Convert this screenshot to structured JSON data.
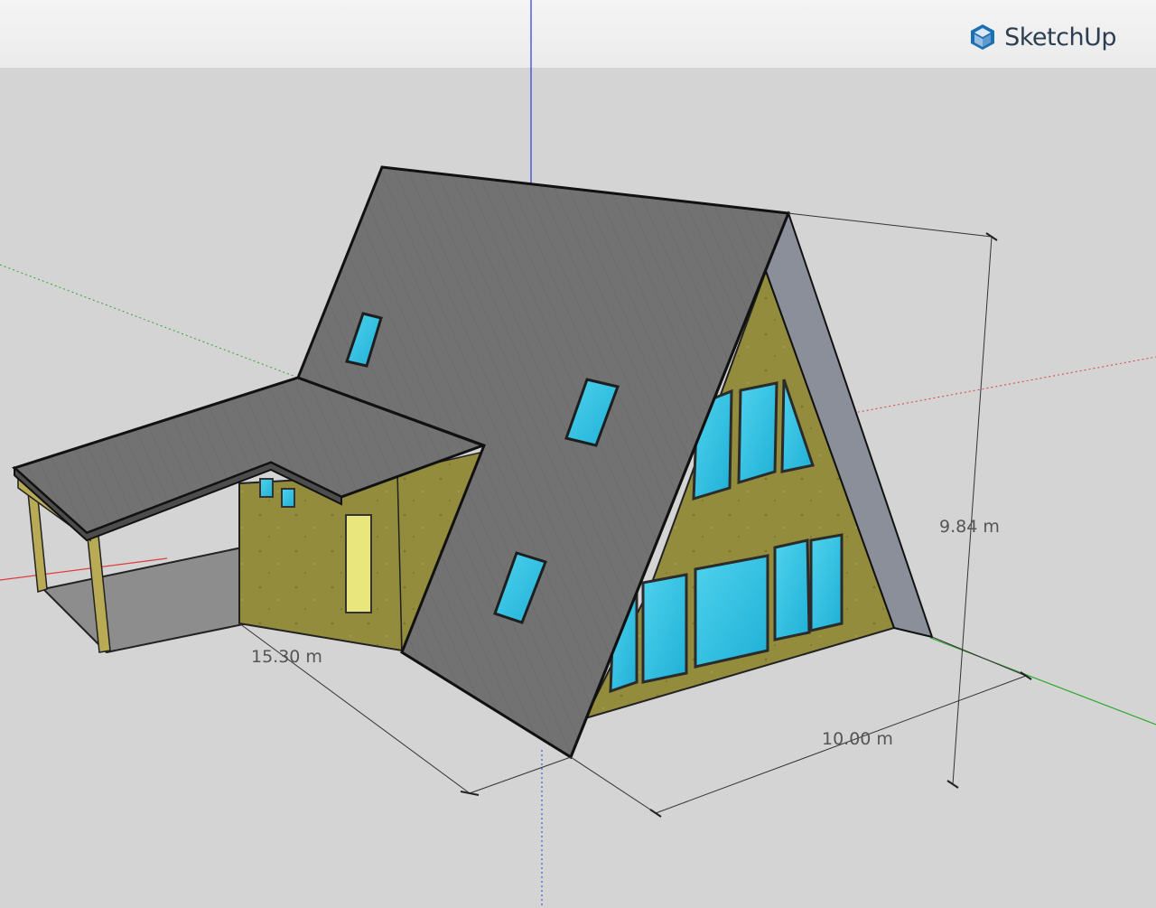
{
  "app": {
    "name": "SketchUp",
    "logo_icon": "sketchup-logo-icon"
  },
  "colors": {
    "sky": "#f0f0f0",
    "ground": "#d4d4d4",
    "roof": "#6f6f6f",
    "roof_edge": "#8a8f99",
    "wall": "#8f8a3a",
    "glass": "#35c3e3",
    "frame": "#c2b36a",
    "axis_red": "#e03a3a",
    "axis_green": "#2ca82c",
    "axis_blue": "#2a3ccf",
    "brand_blue": "#1a6fb5",
    "brand_text": "#2d3e52"
  },
  "dimensions": {
    "length": "15.30 m",
    "width": "10.00 m",
    "height": "9.84 m"
  }
}
